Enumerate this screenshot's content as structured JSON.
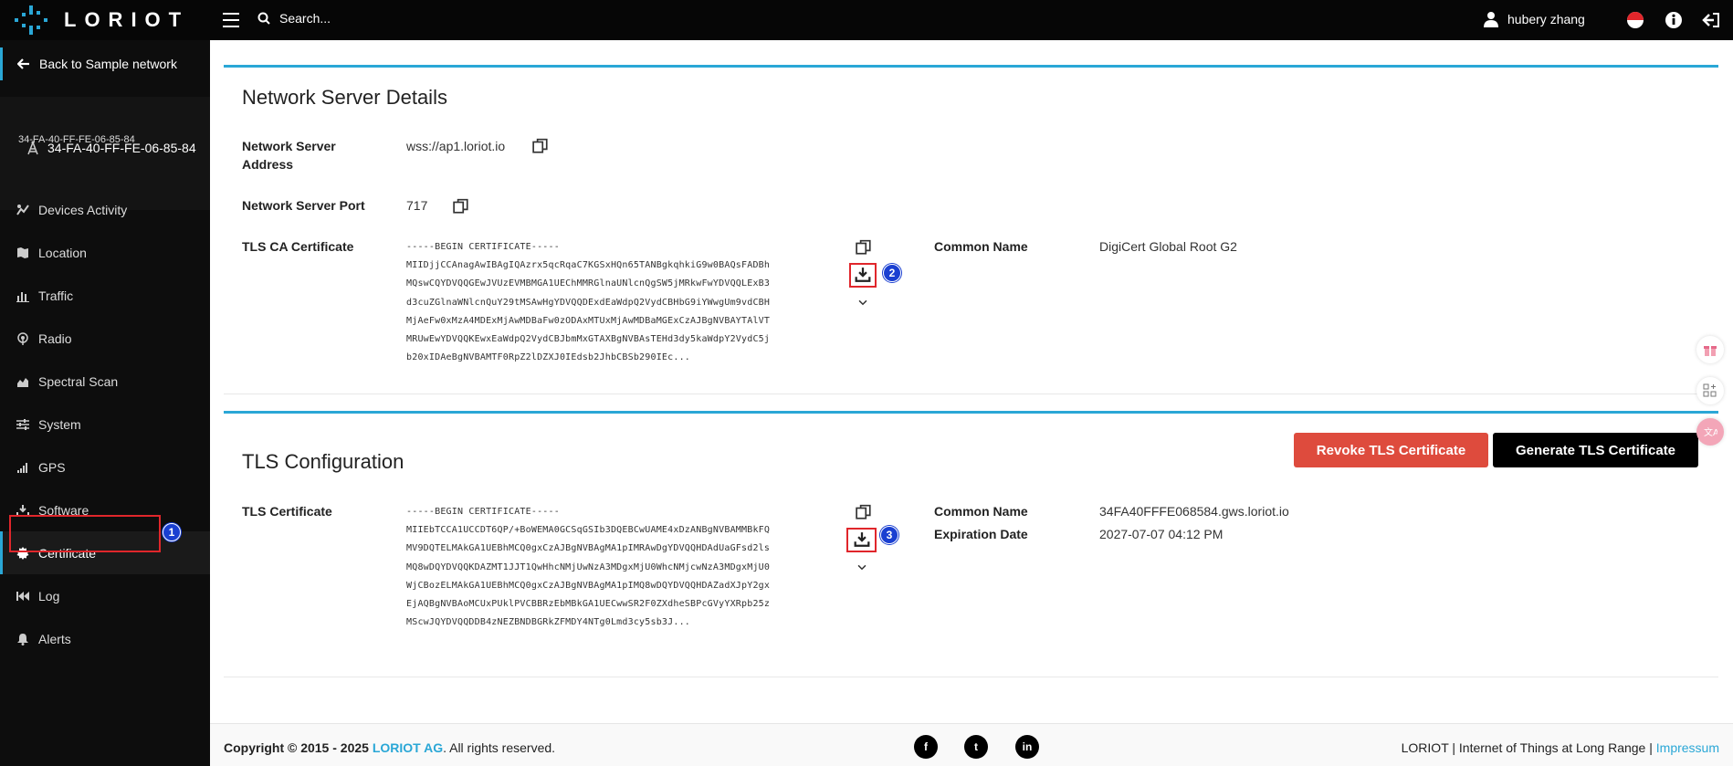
{
  "topbar": {
    "logo_text": "LORIOT",
    "search_placeholder": "Search...",
    "user_name": "hubery zhang"
  },
  "sidebar": {
    "back_label": "Back to Sample network",
    "gateway_name": "34-FA-40-FF-FE-06-85-84",
    "gateway_sub": "34-FA-40-FF-FE-06-85-84",
    "items": [
      {
        "label": "Devices Activity",
        "icon": "devices-activity-icon"
      },
      {
        "label": "Location",
        "icon": "map-icon"
      },
      {
        "label": "Traffic",
        "icon": "bar-chart-icon"
      },
      {
        "label": "Radio",
        "icon": "radio-icon"
      },
      {
        "label": "Spectral Scan",
        "icon": "area-chart-icon"
      },
      {
        "label": "System",
        "icon": "sliders-icon"
      },
      {
        "label": "GPS",
        "icon": "signal-icon"
      },
      {
        "label": "Software",
        "icon": "download-icon"
      },
      {
        "label": "Certificate",
        "icon": "certificate-icon",
        "active": true
      },
      {
        "label": "Log",
        "icon": "rewind-icon"
      },
      {
        "label": "Alerts",
        "icon": "bell-icon"
      }
    ]
  },
  "annotations": {
    "badge1": "1",
    "badge2": "2",
    "badge3": "3"
  },
  "network_server": {
    "title": "Network Server Details",
    "address_label": "Network Server Address",
    "address_value": "wss://ap1.loriot.io",
    "port_label": "Network Server Port",
    "port_value": "717",
    "ca_label": "TLS CA Certificate",
    "ca_cert": "-----BEGIN CERTIFICATE-----\nMIIDjjCCAnagAwIBAgIQAzrx5qcRqaC7KGSxHQn65TANBgkqhkiG9w0BAQsFADBh\nMQswCQYDVQQGEwJVUzEVMBMGA1UEChMMRGlnaUNlcnQgSW5jMRkwFwYDVQQLExB3\nd3cuZGlnaWNlcnQuY29tMSAwHgYDVQQDExdEaWdpQ2VydCBHbG9iYWwgUm9vdCBH\nMjAeFw0xMzA4MDExMjAwMDBaFw0zODAxMTUxMjAwMDBaMGExCzAJBgNVBAYTAlVT\nMRUwEwYDVQQKEwxEaWdpQ2VydCBJbmMxGTAXBgNVBAsTEHd3dy5kaWdpY2VydC5j\nb20xIDAeBgNVBAMTF0RpZ2lDZXJ0IEdsb2JhbCBSb290IEc...",
    "cn_label": "Common Name",
    "cn_value": "DigiCert Global Root G2"
  },
  "tls": {
    "title": "TLS Configuration",
    "revoke_label": "Revoke TLS Certificate",
    "generate_label": "Generate TLS Certificate",
    "cert_label": "TLS Certificate",
    "cert": "-----BEGIN CERTIFICATE-----\nMIIEbTCCA1UCCDT6QP/+BoWEMA0GCSqGSIb3DQEBCwUAME4xDzANBgNVBAMMBkFQ\nMV9DQTELMAkGA1UEBhMCQ0gxCzAJBgNVBAgMA1pIMRAwDgYDVQQHDAdUaGFsd2ls\nMQ8wDQYDVQQKDAZMT1JJT1QwHhcNMjUwNzA3MDgxMjU0WhcNMjcwNzA3MDgxMjU0\nWjCBozELMAkGA1UEBhMCQ0gxCzAJBgNVBAgMA1pIMQ8wDQYDVQQHDAZadXJpY2gx\nEjAQBgNVBAoMCUxPUklPVCBBRzEbMBkGA1UECwwSR2F0ZXdheSBPcGVyYXRpb25z\nMScwJQYDVQQDDB4zNEZBNDBGRkZFMDY4NTg0Lmd3cy5sb3J...",
    "cn_label": "Common Name",
    "cn_value": "34FA40FFFE068584.gws.loriot.io",
    "exp_label": "Expiration Date",
    "exp_value": "2027-07-07 04:12 PM"
  },
  "footer": {
    "copyright": "Copyright © 2015 - 2025",
    "brand": "LORIOT AG",
    "rights": ". All rights reserved.",
    "right_text": "LORIOT | Internet of Things at Long Range |",
    "impressum": "Impressum",
    "social": [
      "f",
      "t",
      "in"
    ]
  },
  "colors": {
    "accent": "#2aa7d6",
    "revoke": "#de4b3d",
    "highlight": "#e0262b",
    "badge": "#1a3fd1"
  }
}
